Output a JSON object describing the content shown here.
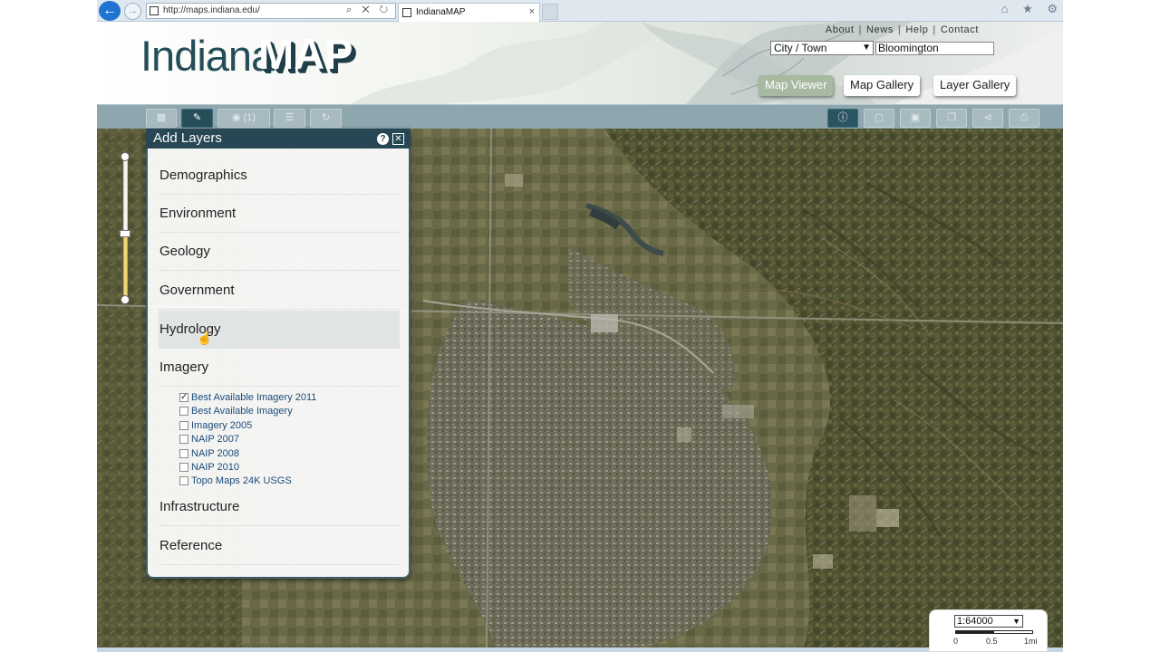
{
  "browser": {
    "url": "http://maps.indiana.edu/",
    "tab_title": "IndianaMAP",
    "tab_close": "×",
    "address_tools": "⌕ ✕ ↻",
    "chrome_icons": "⌂ ★ ⚙"
  },
  "header": {
    "logo_part1": "Indiana",
    "logo_part2": "MAP",
    "links": [
      "About",
      "News",
      "Help",
      "Contact"
    ],
    "location_select": "City / Town",
    "location_input": "Bloomington",
    "nav": [
      "Map Viewer",
      "Map Gallery",
      "Layer Gallery"
    ]
  },
  "toolbar": {
    "layer_count": "(1)"
  },
  "panel": {
    "title": "Add Layers",
    "categories": [
      "Demographics",
      "Environment",
      "Geology",
      "Government",
      "Hydrology",
      "Imagery",
      "Infrastructure",
      "Reference"
    ],
    "imagery_layers": [
      {
        "label": "Best Available Imagery 2011",
        "checked": true
      },
      {
        "label": "Best Available Imagery",
        "checked": false
      },
      {
        "label": "Imagery 2005",
        "checked": false
      },
      {
        "label": "NAIP 2007",
        "checked": false
      },
      {
        "label": "NAIP 2008",
        "checked": false
      },
      {
        "label": "NAIP 2010",
        "checked": false
      },
      {
        "label": "Topo Maps 24K USGS",
        "checked": false
      }
    ],
    "checkmark": "✓"
  },
  "scale": {
    "value": "1:64000",
    "labels": [
      "0",
      "0.5",
      "1mi"
    ]
  },
  "colors": {
    "header_dark": "#264753",
    "toolbar": "#8ea6ad",
    "link_blue": "#1b4b7a"
  }
}
